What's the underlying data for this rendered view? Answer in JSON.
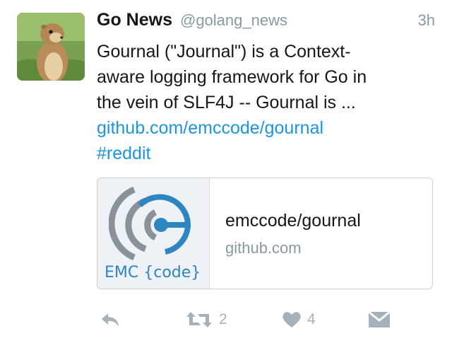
{
  "tweet": {
    "author": {
      "name": "Go News",
      "handle": "@golang_news"
    },
    "time": "3h",
    "text_lines": [
      "Gournal (\"Journal\") is a Context-",
      "aware logging framework for Go in",
      "the vein of SLF4J -- Gournal is ..."
    ],
    "link": "github.com/emccode/gournal",
    "hashtag": "#reddit",
    "card": {
      "brand": "EMC {code}",
      "title": "emccode/gournal",
      "domain": "github.com"
    },
    "actions": {
      "retweets": "2",
      "likes": "4"
    },
    "icons": {
      "reply": "reply-icon",
      "retweet": "retweet-icon",
      "like": "heart-icon",
      "dm": "envelope-icon"
    },
    "colors": {
      "link": "#1b95e0",
      "muted": "#8899a6",
      "icon": "#a5b2bc",
      "brand": "#2e86c1"
    }
  }
}
